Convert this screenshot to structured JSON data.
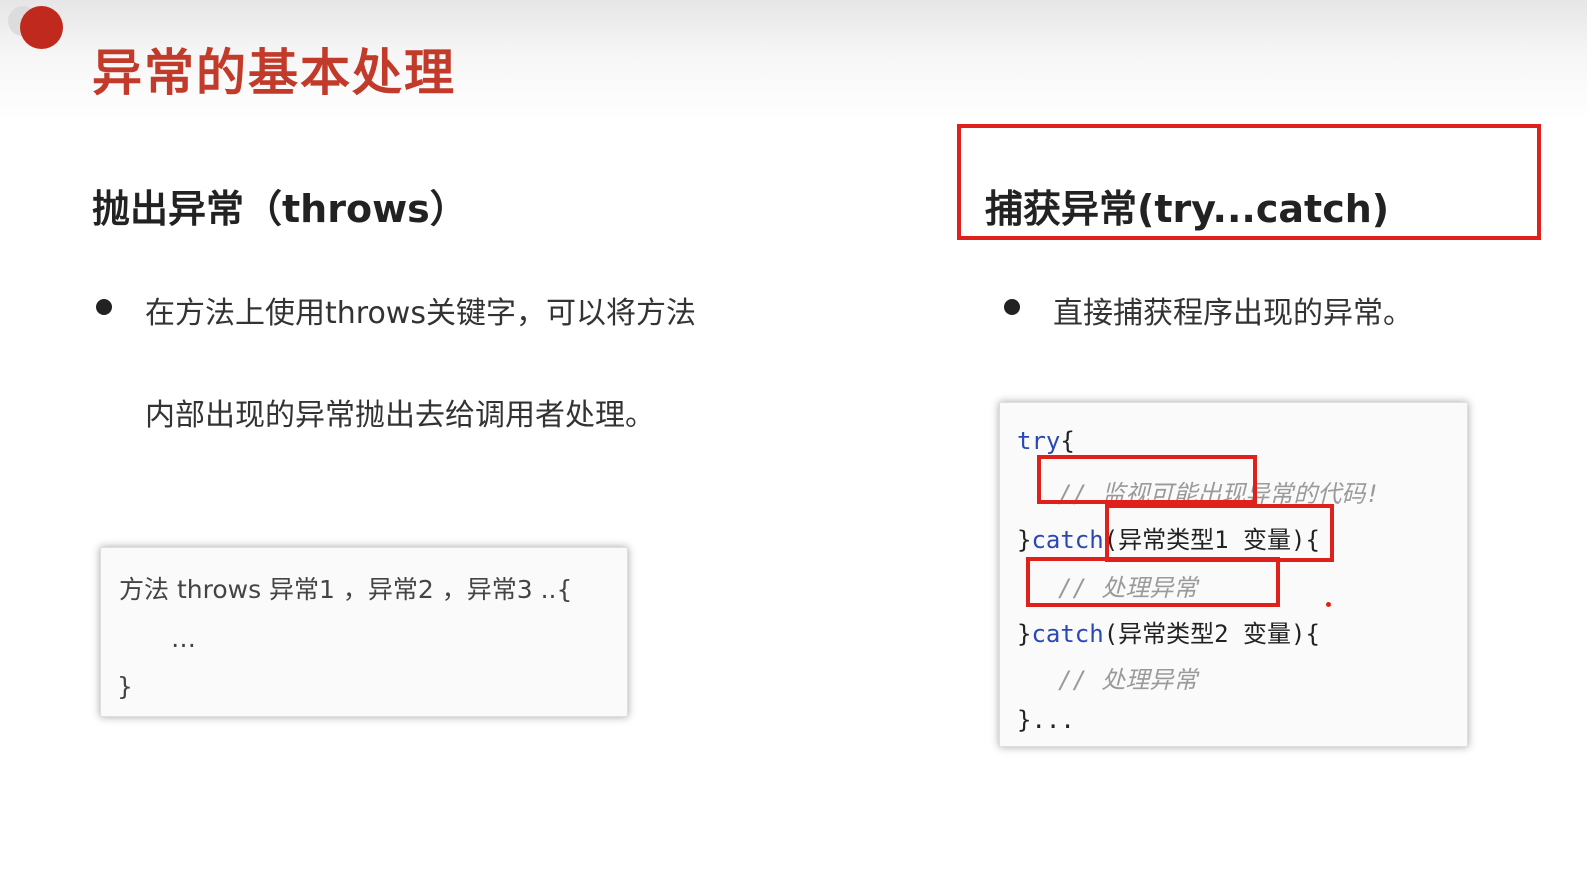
{
  "title": "异常的基本处理",
  "left": {
    "heading": "抛出异常（throws）",
    "bullet_line1": "在方法上使用throws关键字，可以将方法",
    "bullet_line2": "内部出现的异常抛出去给调用者处理。",
    "code": {
      "line1": "方法 throws 异常1 ，异常2 ，异常3 ..{",
      "line2": "…",
      "line3": "}"
    }
  },
  "right": {
    "heading": "捕获异常(try...catch)",
    "bullet": "直接捕获程序出现的异常。",
    "code": {
      "kw_try": "try",
      "brace_open": "{",
      "comment_monitor": "// 监视可能出现异常的代码!",
      "catch_prefix": "}",
      "kw_catch": "catch",
      "catch1_args": "(异常类型1 变量){",
      "comment_handle_1": "// 处理异常",
      "catch2_args": "(异常类型2 变量){",
      "comment_handle_2": "// 处理异常",
      "end": "}..."
    }
  },
  "colors": {
    "title_red": "#c23a2a",
    "dot_red": "#c0291d",
    "highlight_red": "#e0201a",
    "keyword_blue": "#2a47b8",
    "comment_gray": "#9a9a9a"
  }
}
